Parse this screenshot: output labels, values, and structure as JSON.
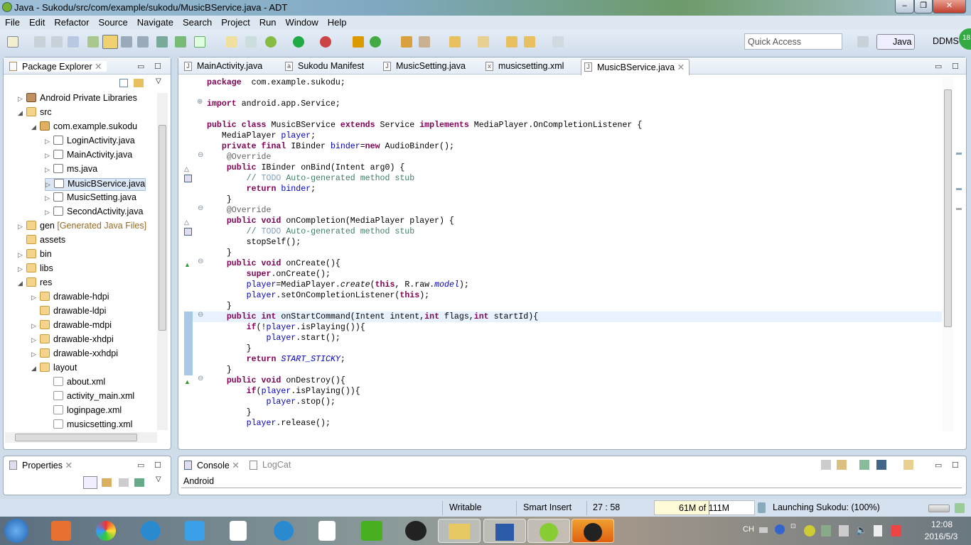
{
  "window": {
    "title": "Java - Sukodu/src/com/example/sukodu/MusicBService.java - ADT",
    "controls": [
      "minimize",
      "maximize",
      "close"
    ]
  },
  "menu": [
    "File",
    "Edit",
    "Refactor",
    "Source",
    "Navigate",
    "Search",
    "Project",
    "Run",
    "Window",
    "Help"
  ],
  "toolbar": {
    "quick_access_placeholder": "Quick Access",
    "perspectives": [
      "Java",
      "DDMS"
    ],
    "badge": "18"
  },
  "package_explorer": {
    "title": "Package Explorer",
    "items": [
      {
        "label": "Android Private Libraries",
        "depth": 1,
        "expand": "collapsed",
        "icon": "lib"
      },
      {
        "label": "src",
        "depth": 1,
        "expand": "expanded",
        "icon": "folder"
      },
      {
        "label": "com.example.sukodu",
        "depth": 2,
        "expand": "expanded",
        "icon": "pkg"
      },
      {
        "label": "LoginActivity.java",
        "depth": 3,
        "expand": "collapsed",
        "icon": "java"
      },
      {
        "label": "MainActivity.java",
        "depth": 3,
        "expand": "collapsed",
        "icon": "java"
      },
      {
        "label": "ms.java",
        "depth": 3,
        "expand": "collapsed",
        "icon": "java"
      },
      {
        "label": "MusicBService.java",
        "depth": 3,
        "expand": "collapsed",
        "icon": "java",
        "selected": true
      },
      {
        "label": "MusicSetting.java",
        "depth": 3,
        "expand": "collapsed",
        "icon": "java"
      },
      {
        "label": "SecondActivity.java",
        "depth": 3,
        "expand": "collapsed",
        "icon": "java"
      },
      {
        "label": "gen",
        "suffix": "[Generated Java Files]",
        "depth": 1,
        "expand": "collapsed",
        "icon": "folder"
      },
      {
        "label": "assets",
        "depth": 1,
        "expand": "none",
        "icon": "folder"
      },
      {
        "label": "bin",
        "depth": 1,
        "expand": "collapsed",
        "icon": "folder"
      },
      {
        "label": "libs",
        "depth": 1,
        "expand": "collapsed",
        "icon": "folder"
      },
      {
        "label": "res",
        "depth": 1,
        "expand": "expanded",
        "icon": "folder"
      },
      {
        "label": "drawable-hdpi",
        "depth": 2,
        "expand": "collapsed",
        "icon": "folder"
      },
      {
        "label": "drawable-ldpi",
        "depth": 2,
        "expand": "none",
        "icon": "folder"
      },
      {
        "label": "drawable-mdpi",
        "depth": 2,
        "expand": "collapsed",
        "icon": "folder"
      },
      {
        "label": "drawable-xhdpi",
        "depth": 2,
        "expand": "collapsed",
        "icon": "folder"
      },
      {
        "label": "drawable-xxhdpi",
        "depth": 2,
        "expand": "collapsed",
        "icon": "folder"
      },
      {
        "label": "layout",
        "depth": 2,
        "expand": "expanded",
        "icon": "folder"
      },
      {
        "label": "about.xml",
        "depth": 3,
        "expand": "none",
        "icon": "xml"
      },
      {
        "label": "activity_main.xml",
        "depth": 3,
        "expand": "none",
        "icon": "xml"
      },
      {
        "label": "loginpage.xml",
        "depth": 3,
        "expand": "none",
        "icon": "xml"
      },
      {
        "label": "musicsetting.xml",
        "depth": 3,
        "expand": "none",
        "icon": "xml"
      }
    ]
  },
  "editor": {
    "tabs": [
      {
        "label": "MainActivity.java",
        "icon": "J"
      },
      {
        "label": "Sukodu Manifest",
        "icon": "a"
      },
      {
        "label": "MusicSetting.java",
        "icon": "J"
      },
      {
        "label": "musicsetting.xml",
        "icon": "x"
      },
      {
        "label": "MusicBService.java",
        "icon": "J",
        "active": true
      }
    ],
    "highlighted_line": 23,
    "lines": [
      [
        [
          "k",
          "package"
        ],
        [
          "",
          "  com.example.sukodu;"
        ]
      ],
      [],
      [
        [
          "k",
          "import"
        ],
        [
          "",
          " android.app.Service;"
        ]
      ],
      [],
      [
        [
          "k",
          "public class"
        ],
        [
          "",
          " MusicBService "
        ],
        [
          "k",
          "extends"
        ],
        [
          "",
          " Service "
        ],
        [
          "k",
          "implements"
        ],
        [
          "",
          " MediaPlayer.OnCompletionListener {"
        ]
      ],
      [
        [
          "",
          "   MediaPlayer "
        ],
        [
          "f",
          "player"
        ],
        [
          "",
          ";"
        ]
      ],
      [
        [
          "",
          "   "
        ],
        [
          "k",
          "private final"
        ],
        [
          "",
          " IBinder "
        ],
        [
          "f",
          "binder"
        ],
        [
          "",
          "="
        ],
        [
          "k",
          "new"
        ],
        [
          "",
          " AudioBinder();"
        ]
      ],
      [
        [
          "a",
          "    @Override"
        ]
      ],
      [
        [
          "",
          "    "
        ],
        [
          "k",
          "public"
        ],
        [
          "",
          " IBinder onBind(Intent arg0) {"
        ]
      ],
      [
        [
          "c",
          "        // "
        ],
        [
          "td",
          "TODO"
        ],
        [
          "c",
          " Auto-generated method stub"
        ]
      ],
      [
        [
          "",
          "        "
        ],
        [
          "k",
          "return"
        ],
        [
          "f",
          " binder"
        ],
        [
          "",
          ";"
        ]
      ],
      [
        [
          "",
          "    }"
        ]
      ],
      [
        [
          "a",
          "    @Override"
        ]
      ],
      [
        [
          "",
          "    "
        ],
        [
          "k",
          "public void"
        ],
        [
          "",
          " onCompletion(MediaPlayer player) {"
        ]
      ],
      [
        [
          "c",
          "        // "
        ],
        [
          "td",
          "TODO"
        ],
        [
          "c",
          " Auto-generated method stub"
        ]
      ],
      [
        [
          "",
          "        stopSelf();"
        ]
      ],
      [
        [
          "",
          "    }"
        ]
      ],
      [
        [
          "",
          "    "
        ],
        [
          "k",
          "public void"
        ],
        [
          "",
          " onCreate(){"
        ]
      ],
      [
        [
          "",
          "        "
        ],
        [
          "k",
          "super"
        ],
        [
          "",
          ".onCreate();"
        ]
      ],
      [
        [
          "",
          "        "
        ],
        [
          "f",
          "player"
        ],
        [
          "",
          "=MediaPlayer."
        ],
        [
          "i",
          "create"
        ],
        [
          "",
          "("
        ],
        [
          "k",
          "this"
        ],
        [
          "",
          ", R.raw."
        ],
        [
          "fi",
          "model"
        ],
        [
          "",
          ");"
        ]
      ],
      [
        [
          "",
          "        "
        ],
        [
          "f",
          "player"
        ],
        [
          "",
          ".setOnCompletionListener("
        ],
        [
          "k",
          "this"
        ],
        [
          "",
          ");"
        ]
      ],
      [
        [
          "",
          "    }"
        ]
      ],
      [
        [
          "",
          "    "
        ],
        [
          "k",
          "public int"
        ],
        [
          "",
          " onStartCommand(Intent intent,"
        ],
        [
          "k",
          "int"
        ],
        [
          "",
          " flags,"
        ],
        [
          "k",
          "int"
        ],
        [
          "",
          " startId){"
        ]
      ],
      [
        [
          "",
          "        "
        ],
        [
          "k",
          "if"
        ],
        [
          "",
          "(!"
        ],
        [
          "f",
          "player"
        ],
        [
          "",
          ".isPlaying()){"
        ]
      ],
      [
        [
          "",
          "            "
        ],
        [
          "f",
          "player"
        ],
        [
          "",
          ".start();"
        ]
      ],
      [
        [
          "",
          "        }"
        ]
      ],
      [
        [
          "",
          "        "
        ],
        [
          "k",
          "return"
        ],
        [
          "",
          " "
        ],
        [
          "fi",
          "START_STICKY"
        ],
        [
          "",
          ";"
        ]
      ],
      [
        [
          "",
          "    }"
        ]
      ],
      [
        [
          "",
          "    "
        ],
        [
          "k",
          "public void"
        ],
        [
          "",
          " onDestroy(){"
        ]
      ],
      [
        [
          "",
          "        "
        ],
        [
          "k",
          "if"
        ],
        [
          "",
          "("
        ],
        [
          "f",
          "player"
        ],
        [
          "",
          ".isPlaying()){"
        ]
      ],
      [
        [
          "",
          "            "
        ],
        [
          "f",
          "player"
        ],
        [
          "",
          ".stop();"
        ]
      ],
      [
        [
          "",
          "        }"
        ]
      ],
      [
        [
          "",
          "        "
        ],
        [
          "f",
          "player"
        ],
        [
          "",
          ".release();"
        ]
      ]
    ]
  },
  "properties": {
    "title": "Properties"
  },
  "console": {
    "tabs": [
      "Console",
      "LogCat"
    ],
    "content": "Android"
  },
  "status": {
    "writable": "Writable",
    "insert_mode": "Smart Insert",
    "position": "27 : 58",
    "heap": "61M of 111M",
    "heap_used_fraction": 0.55,
    "progress": "Launching Sukodu: (100%)"
  },
  "taskbar": {
    "tray_lang": "CH",
    "time": "12:08",
    "date": "2016/5/3"
  }
}
